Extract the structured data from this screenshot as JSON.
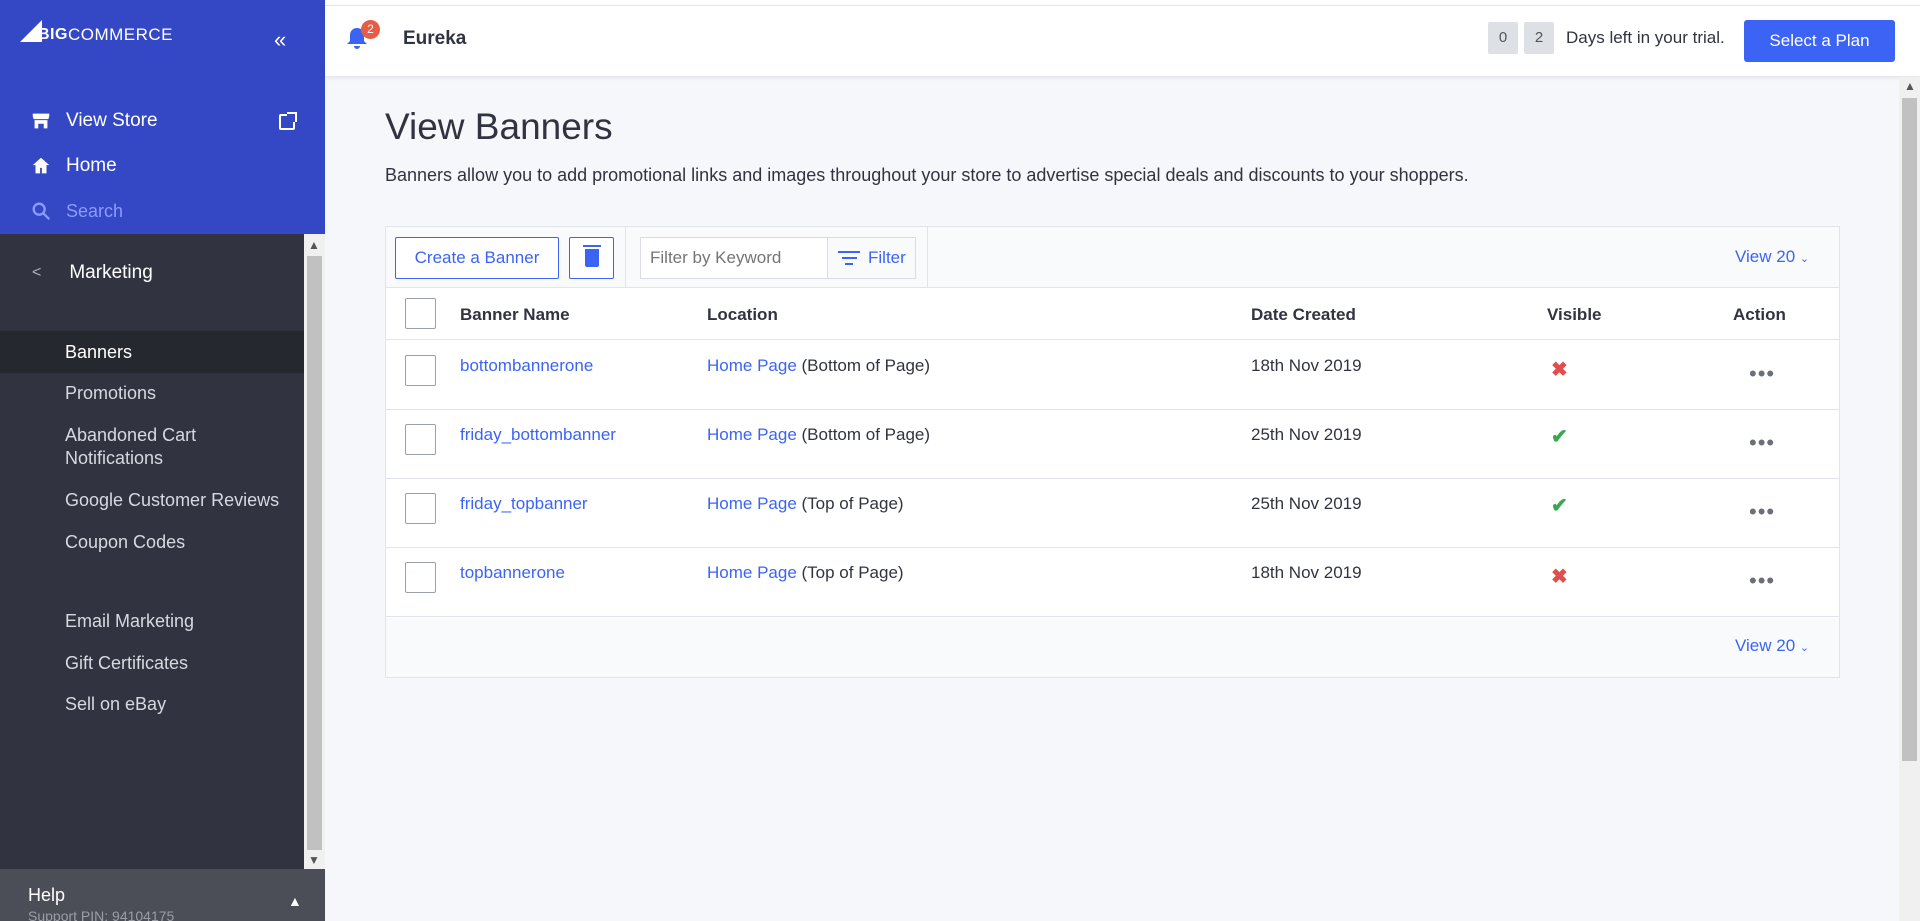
{
  "sidebar": {
    "logo_text": "BIGCOMMERCE",
    "logo_big": "BIG",
    "logo_rest": "COMMERCE",
    "collapse_glyph": "«",
    "links": {
      "view_store": "View Store",
      "home": "Home",
      "search": "Search"
    },
    "section": "Marketing",
    "items": [
      {
        "label": "Banners",
        "active": true
      },
      {
        "label": "Promotions"
      },
      {
        "label": "Abandoned Cart\nNotifications"
      },
      {
        "label": "Google Customer Reviews"
      },
      {
        "label": "Coupon Codes"
      },
      {
        "label": "Email Marketing"
      },
      {
        "label": "Gift Certificates"
      },
      {
        "label": "Sell on eBay"
      }
    ],
    "help": {
      "title": "Help",
      "support_pin": "Support PIN: 94104175"
    }
  },
  "topbar": {
    "notification_count": "2",
    "store_name": "Eureka",
    "trial_digits": [
      "0",
      "2"
    ],
    "trial_text": "Days left in your trial.",
    "plan_button": "Select a Plan"
  },
  "page": {
    "title": "View Banners",
    "description": "Banners allow you to add promotional links and images throughout your store to advertise special deals and discounts to your shoppers."
  },
  "toolbar": {
    "create_button": "Create a Banner",
    "filter_placeholder": "Filter by Keyword",
    "filter_button": "Filter",
    "view_count": "View 20"
  },
  "table": {
    "headers": {
      "name": "Banner Name",
      "location": "Location",
      "date": "Date Created",
      "visible": "Visible",
      "action": "Action"
    },
    "rows": [
      {
        "name": "bottombannerone",
        "location_link": "Home Page",
        "location_detail": "(Bottom of Page)",
        "date": "18th Nov 2019",
        "visible": false
      },
      {
        "name": "friday_bottombanner",
        "location_link": "Home Page",
        "location_detail": "(Bottom of Page)",
        "date": "25th Nov 2019",
        "visible": true
      },
      {
        "name": "friday_topbanner",
        "location_link": "Home Page",
        "location_detail": "(Top of Page)",
        "date": "25th Nov 2019",
        "visible": true
      },
      {
        "name": "topbannerone",
        "location_link": "Home Page",
        "location_detail": "(Top of Page)",
        "date": "18th Nov 2019",
        "visible": false
      }
    ],
    "visible_glyphs": {
      "true": "✔",
      "false": "✖"
    },
    "action_glyph": "•••",
    "footer_view_count": "View 20"
  },
  "colors": {
    "brand_blue": "#3448c5",
    "accent": "#3c64f4",
    "sidebar_dark": "#313440",
    "error_red": "#e04e4e",
    "success_green": "#3aa650"
  }
}
